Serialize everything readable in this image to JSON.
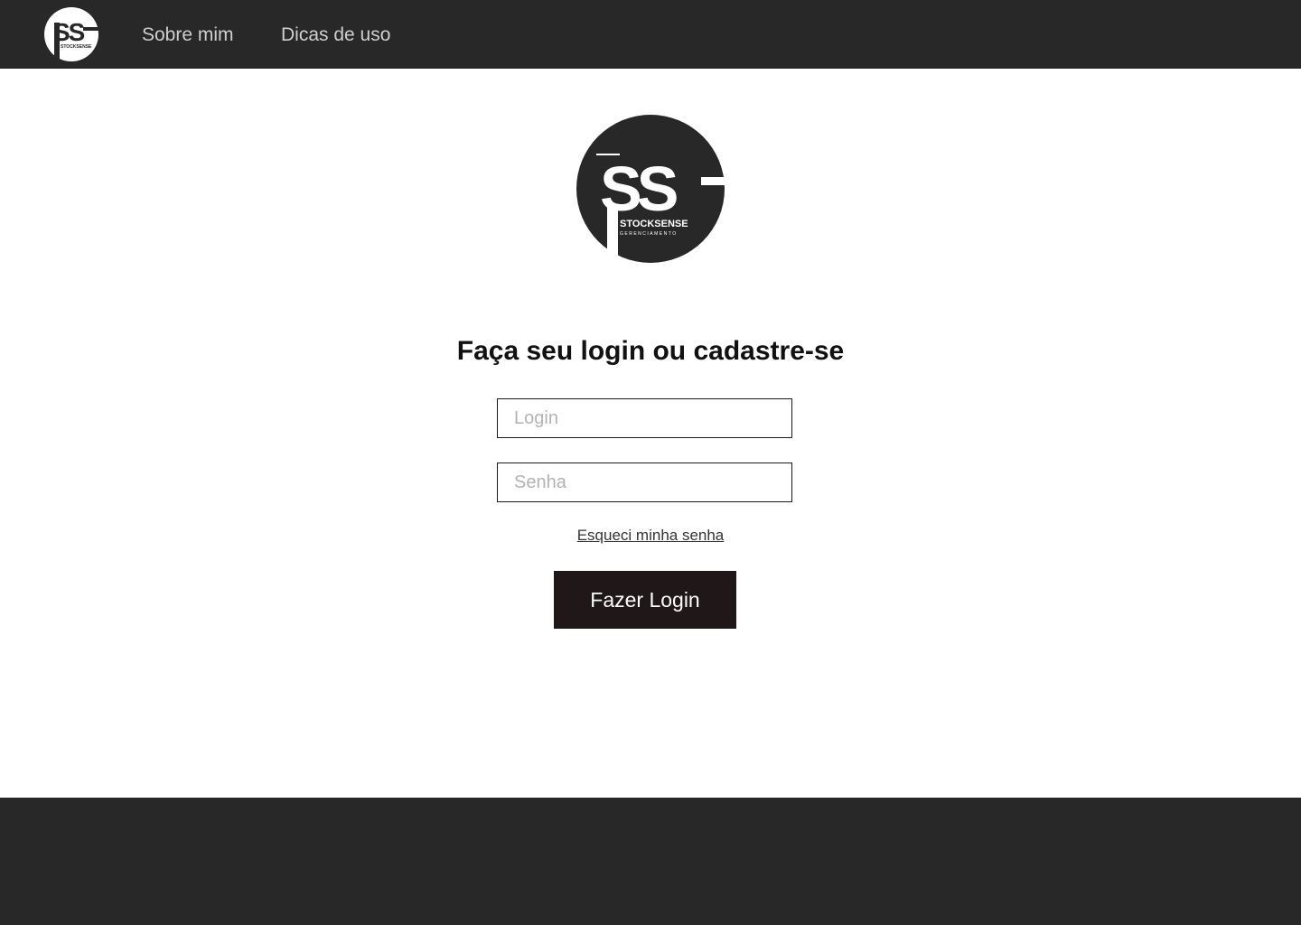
{
  "nav": {
    "logo_text": "STOCKSENSE",
    "links": [
      {
        "label": "Sobre mim"
      },
      {
        "label": "Dicas de uso"
      }
    ]
  },
  "brand": {
    "monogram": "SS",
    "name": "STOCKSENSE",
    "tagline": "GERENCIAMENTO"
  },
  "login": {
    "title": "Faça seu login ou cadastre-se",
    "login_placeholder": "Login",
    "password_placeholder": "Senha",
    "forgot_label": "Esqueci minha senha",
    "submit_label": "Fazer Login"
  },
  "colors": {
    "bar": "#282828",
    "button": "#1f1718",
    "nav_text": "#cfcfcf"
  }
}
